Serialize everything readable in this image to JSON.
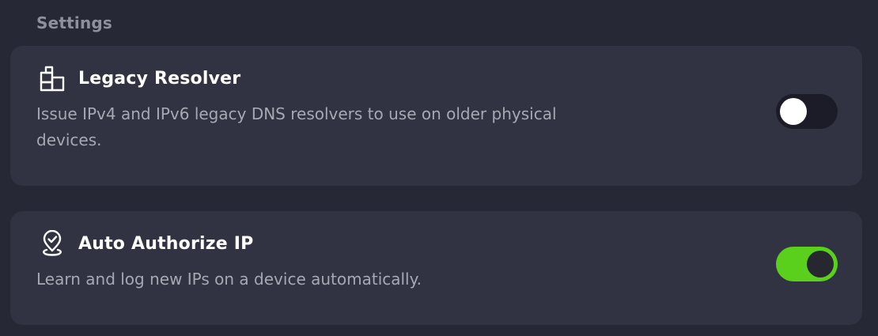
{
  "settings": {
    "title": "Settings",
    "cards": [
      {
        "title": "Legacy Resolver",
        "description": "Issue IPv4 and IPv6 legacy DNS resolvers to use on older physical devices.",
        "icon": "legacy-resolver-icon",
        "toggle_on": false
      },
      {
        "title": "Auto Authorize IP",
        "description": "Learn and log new IPs on a device automatically.",
        "icon": "location-check-icon",
        "toggle_on": true
      }
    ]
  },
  "colors": {
    "background": "#272836",
    "card": "#313342",
    "toggle_on": "#5ad01d",
    "toggle_off": "#1b1c27"
  }
}
